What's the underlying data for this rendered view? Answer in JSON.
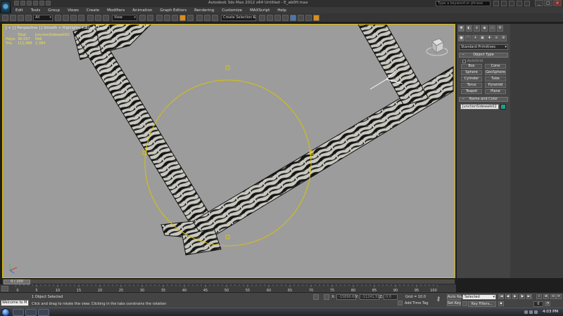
{
  "title_bar": {
    "title": "Autodesk 3ds Max 2012 x64      Untitled - E_ab0H.max",
    "search_placeholder": "Type a keyword or phrase"
  },
  "menu": [
    "Edit",
    "Tools",
    "Group",
    "Views",
    "Create",
    "Modifiers",
    "Animation",
    "Graph Editors",
    "Rendering",
    "Customize",
    "MAXScript",
    "Help"
  ],
  "toolbar": {
    "filter_value": "All",
    "refcoord_value": "View",
    "selection_set_value": "Create Selection Se"
  },
  "viewport": {
    "label": "[ + ] [ Perspective ] [ Smooth + Highlights + Edged Faces ]",
    "stats": [
      {
        "key": "",
        "a": "Total",
        "b": "JunctionSidewalk02"
      },
      {
        "key": "Polys:",
        "a": "36,557",
        "b": "696"
      },
      {
        "key": "Tris:",
        "a": "111,988",
        "b": "1,384"
      }
    ]
  },
  "command_panel": {
    "primitive_dropdown": "Standard Primitives",
    "rollout_object_type": "Object Type",
    "autogrid_label": "AutoGrid",
    "object_buttons": [
      "Box",
      "Cone",
      "Sphere",
      "GeoSphere",
      "Cylinder",
      "Tube",
      "Torus",
      "Pyramid",
      "Teapot",
      "Plane"
    ],
    "rollout_name_color": "Name and Color",
    "object_name": "JunctionSidewalk02",
    "object_color": "#1ea088"
  },
  "timeline": {
    "frame_counter": "0 / 100",
    "ruler_ticks": [
      "0",
      "5",
      "10",
      "15",
      "20",
      "25",
      "30",
      "35",
      "40",
      "45",
      "50",
      "55",
      "60",
      "65",
      "70",
      "75",
      "80",
      "85",
      "90",
      "95",
      "100"
    ]
  },
  "status_bar": {
    "maxscript_text": "Welcome to M",
    "selection_text": "1 Object Selected",
    "prompt_text": "Click and drag to rotate the view.  Clicking in the tabs constrains the rotation",
    "x_label": "X:",
    "x_value": "-15890.60",
    "y_label": "Y:",
    "y_value": "-11241.59",
    "z_label": "Z:",
    "z_value": "0.0",
    "grid_text": "Grid = 10.0",
    "add_time_tag": "Add Time Tag",
    "auto_key": "Auto Key",
    "set_key": "Set Key",
    "selected_dropdown": "Selected",
    "key_filters": "Key Filters...",
    "current_frame": "0"
  },
  "taskbar": {
    "clock": "4:03 PM"
  }
}
